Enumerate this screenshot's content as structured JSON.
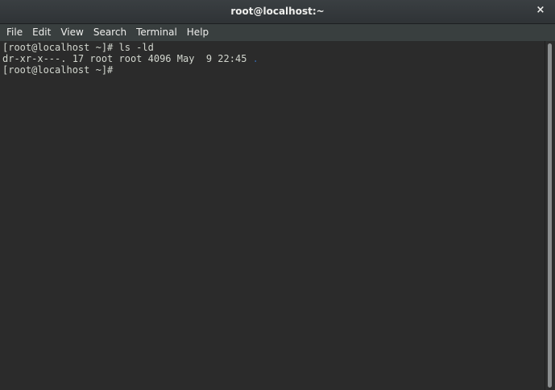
{
  "window": {
    "title": "root@localhost:~",
    "close_glyph": "×"
  },
  "menu": {
    "items": [
      "File",
      "Edit",
      "View",
      "Search",
      "Terminal",
      "Help"
    ]
  },
  "terminal": {
    "line1": "[root@localhost ~]# ls -ld",
    "line2_prefix": "dr-xr-x---. 17 root root 4096 May  9 22:45 ",
    "line2_dir": ".",
    "line3": "[root@localhost ~]# ",
    "dir_color": "#3465a4"
  }
}
